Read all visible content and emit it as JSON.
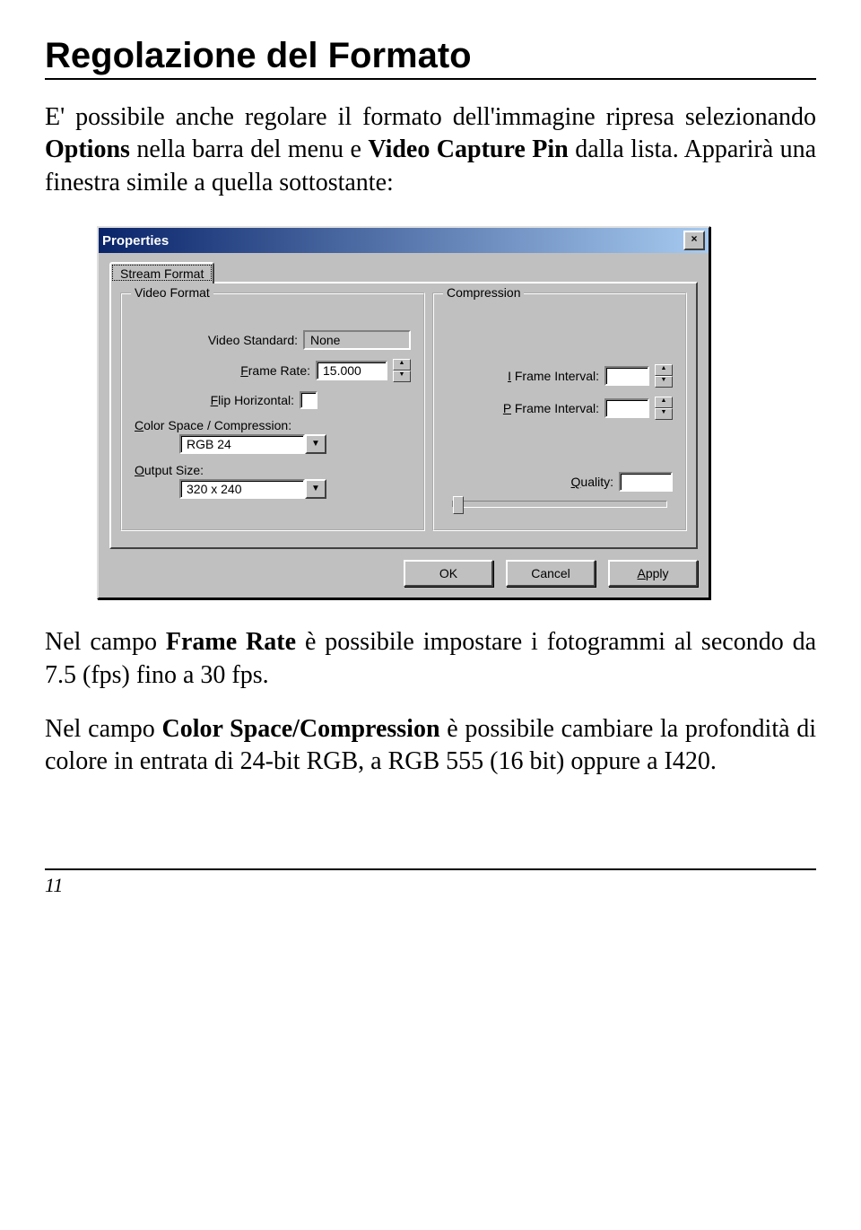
{
  "heading": "Regolazione del Formato",
  "para1_a": "E' possibile anche regolare il formato dell'immagine ripresa selezionando ",
  "para1_b": "Options",
  "para1_c": " nella barra del menu e ",
  "para1_d": "Video Capture Pin",
  "para1_e": " dalla lista. Apparirà una finestra simile a quella sottostante:",
  "dialog": {
    "title": "Properties",
    "close": "×",
    "tab": "Stream Format",
    "group_video": "Video Format",
    "group_comp": "Compression",
    "video_standard_label": "Video Standard:",
    "video_standard_value": "None",
    "frame_rate_label": "Frame Rate:",
    "frame_rate_value": "15.000",
    "flip_label": "Flip Horizontal:",
    "colorspace_label": "Color Space / Compression:",
    "colorspace_value": "RGB 24",
    "output_size_label": "Output Size:",
    "output_size_value": "320 x 240",
    "iframe_label": "I Frame Interval:",
    "pframe_label": "P Frame Interval:",
    "quality_label": "Quality:",
    "ok": "OK",
    "cancel": "Cancel",
    "apply": "Apply"
  },
  "para2_a": "Nel campo ",
  "para2_b": "Frame Rate",
  "para2_c": " è possibile impostare i fotogrammi al secondo da 7.5 (fps) fino a 30 fps.",
  "para3_a": "Nel campo ",
  "para3_b": "Color Space/Compression",
  "para3_c": " è possibile cambiare la profondità di colore in entrata di 24-bit RGB, a RGB 555 (16 bit) oppure a I420.",
  "page_number": "11"
}
